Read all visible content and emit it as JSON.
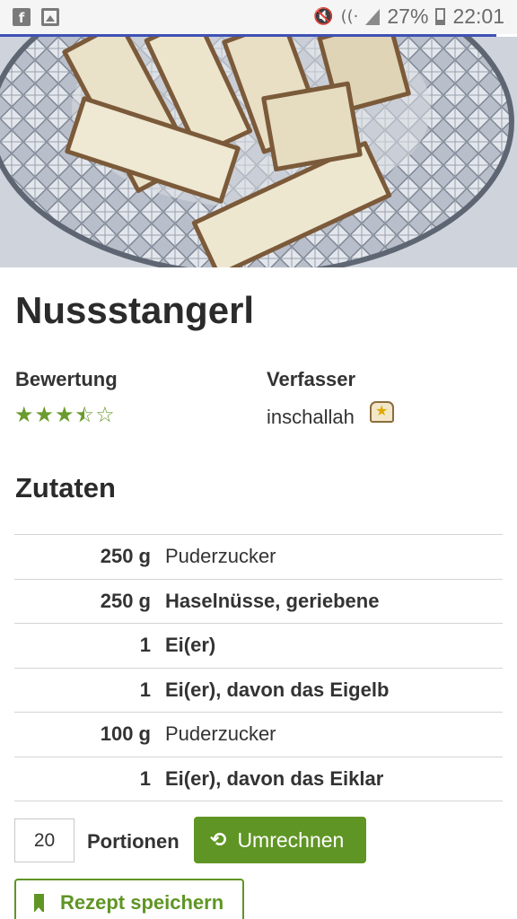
{
  "status_bar": {
    "left_icons": [
      "facebook-icon",
      "image-icon"
    ],
    "right_icons": [
      "mute-icon",
      "wifi-icon",
      "signal-icon",
      "battery-icon"
    ],
    "battery_percent": "27%",
    "time": "22:01"
  },
  "colors": {
    "accent_blue": "#3f51b5",
    "brand_green": "#5f9524",
    "star_green": "#6a9b2e"
  },
  "recipe": {
    "hero_image": "photo of iced nut bars on a crystal glass plate",
    "title": "Nussstangerl",
    "rating_label": "Bewertung",
    "rating_value": 3.5,
    "rating_max": 5,
    "author_label": "Verfasser",
    "author_name": "inschallah",
    "author_badge_icon": "chef-hat-star-icon"
  },
  "ingredients": {
    "heading": "Zutaten",
    "items": [
      {
        "amount": "250 g",
        "name": "Puderzucker",
        "bold": false
      },
      {
        "amount": "250 g",
        "name": "Haselnüsse, geriebene",
        "bold": true
      },
      {
        "amount": "1",
        "name": "Ei(er)",
        "bold": true
      },
      {
        "amount": "1",
        "name": "Ei(er), davon das Eigelb",
        "bold": true
      },
      {
        "amount": "100 g",
        "name": "Puderzucker",
        "bold": false
      },
      {
        "amount": "1",
        "name": "Ei(er), davon das Eiklar",
        "bold": true
      }
    ]
  },
  "portions": {
    "value": "20",
    "label": "Portionen",
    "convert_button": "Umrechnen",
    "convert_icon": "refresh-icon"
  },
  "save_button": {
    "label": "Rezept speichern",
    "icon": "bookmark-icon"
  }
}
